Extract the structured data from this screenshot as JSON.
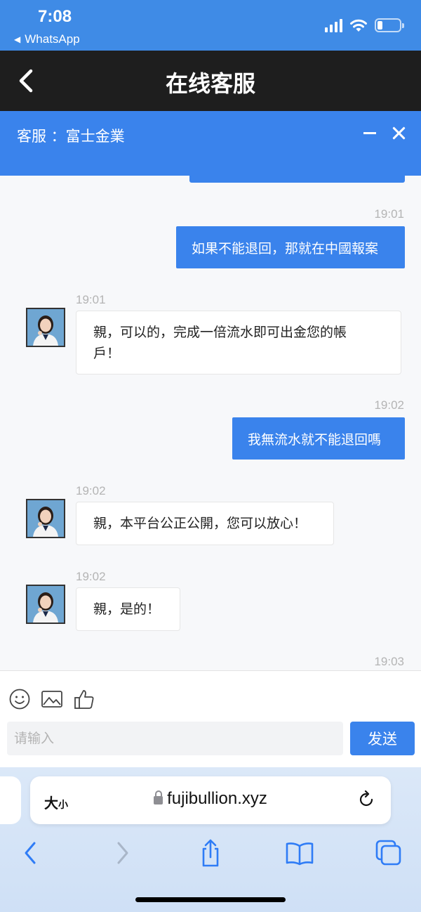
{
  "status_bar": {
    "time": "7:08",
    "back_app": "WhatsApp"
  },
  "header": {
    "title": "在线客服"
  },
  "service": {
    "label": "客服 ：富士金業"
  },
  "messages": [
    {
      "from": "me",
      "time": "19:01",
      "text": "如果不能退回，那就在中國報案"
    },
    {
      "from": "agent",
      "time": "19:01",
      "text_line1": "親，可以的，完成一倍流水即可出金您的帳",
      "text_line2": "戶！"
    },
    {
      "from": "me",
      "time": "19:02",
      "text": "我無流水就不能退回嗎"
    },
    {
      "from": "agent",
      "time": "19:02",
      "text": "親，本平台公正公開，您可以放心！"
    },
    {
      "from": "agent",
      "time": "19:02",
      "text": "親，是的！"
    },
    {
      "from": "me",
      "time": "19:03"
    }
  ],
  "composer": {
    "placeholder": "请输入",
    "send_label": "发送",
    "tools": [
      "emoji-icon",
      "image-icon",
      "thumbs-up-icon"
    ]
  },
  "browser": {
    "text_size_label": "大",
    "text_size_small": "小",
    "url": "fujibullion.xyz"
  },
  "colors": {
    "status_bar": "#3f8be6",
    "title_bar": "#1e1e1e",
    "accent": "#3a83ec",
    "timestamp": "#b4b4b4"
  }
}
